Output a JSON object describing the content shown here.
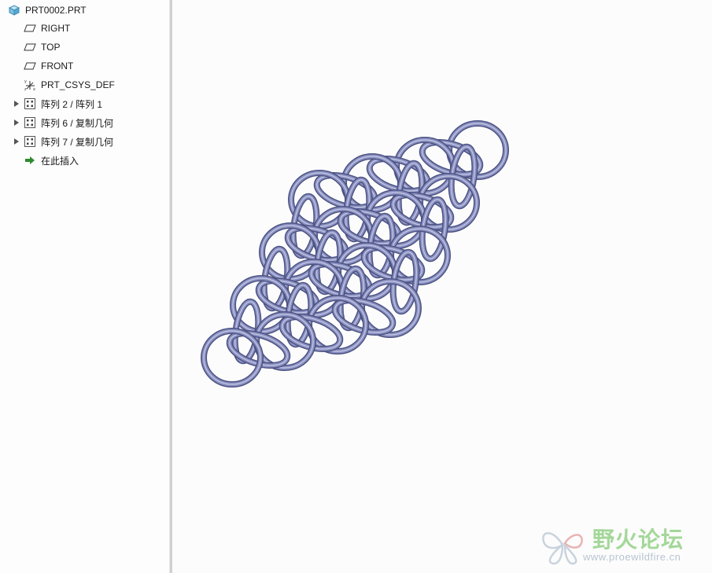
{
  "tree": {
    "root_label": "PRT0002.PRT",
    "items": [
      {
        "label": "RIGHT",
        "icon": "datum-plane-icon",
        "expandable": false
      },
      {
        "label": "TOP",
        "icon": "datum-plane-icon",
        "expandable": false
      },
      {
        "label": "FRONT",
        "icon": "datum-plane-icon",
        "expandable": false
      },
      {
        "label": "PRT_CSYS_DEF",
        "icon": "csys-icon",
        "expandable": false
      },
      {
        "label": "阵列 2 / 阵列 1",
        "icon": "pattern-icon",
        "expandable": true
      },
      {
        "label": "阵列 6 / 复制几何",
        "icon": "pattern-icon",
        "expandable": true
      },
      {
        "label": "阵列 7 / 复制几何",
        "icon": "pattern-icon",
        "expandable": true
      },
      {
        "label": "在此插入",
        "icon": "insert-here-arrow-icon",
        "expandable": false
      }
    ]
  },
  "viewport": {
    "ring_color": "#8a90c0",
    "ring_edge_color": "#4c5383"
  },
  "watermark": {
    "text": "野火论坛",
    "url": "www.proewildfire.cn"
  }
}
